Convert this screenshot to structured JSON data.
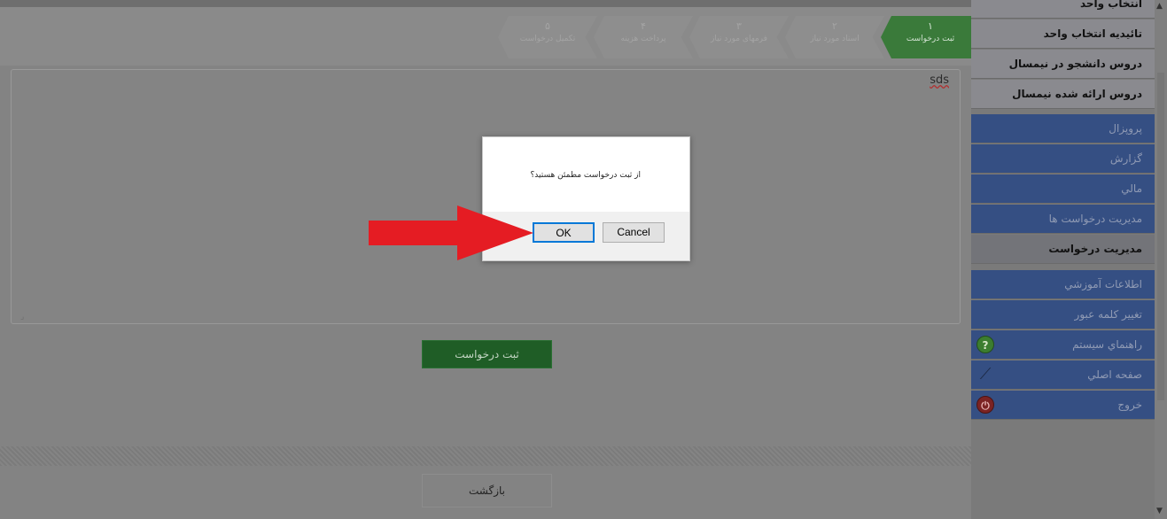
{
  "steps": [
    {
      "num": "۱",
      "label": "ثبت درخواست",
      "active": true
    },
    {
      "num": "۲",
      "label": "اسناد مورد نیاز",
      "active": false
    },
    {
      "num": "۳",
      "label": "فرمهای مورد نیاز",
      "active": false
    },
    {
      "num": "۴",
      "label": "پرداخت هزینه",
      "active": false
    },
    {
      "num": "۵",
      "label": "تکمیل درخواست",
      "active": false
    }
  ],
  "textarea": {
    "value": "sds"
  },
  "buttons": {
    "submit": "ثبت درخواست",
    "back": "بازگشت"
  },
  "dialog": {
    "message": "از ثبت درخواست مطمئن هستید؟",
    "ok": "OK",
    "cancel": "Cancel"
  },
  "sidebar": [
    {
      "label": "انتخاب واحد",
      "style": "light"
    },
    {
      "label": "تائیدیه انتخاب واحد",
      "style": "light"
    },
    {
      "label": "دروس دانشجو در نیمسال",
      "style": "light"
    },
    {
      "label": "دروس ارائه شده نیمسال",
      "style": "light"
    },
    {
      "label": "پروپزال",
      "style": "blue"
    },
    {
      "label": "گزارش",
      "style": "blue"
    },
    {
      "label": "مالي",
      "style": "blue"
    },
    {
      "label": "مديريت درخواست ها",
      "style": "blue"
    },
    {
      "label": "مديريت درخواست",
      "style": "mid"
    },
    {
      "label": "اطلاعات آموزشي",
      "style": "blue"
    },
    {
      "label": "تغيير كلمه عبور",
      "style": "blue"
    },
    {
      "label": "راهنماي سيستم",
      "style": "blue",
      "icon": "help-icon"
    },
    {
      "label": "صفحه اصلي",
      "style": "blue",
      "icon": "home-icon"
    },
    {
      "label": "خروج",
      "style": "blue",
      "icon": "power-icon"
    }
  ]
}
